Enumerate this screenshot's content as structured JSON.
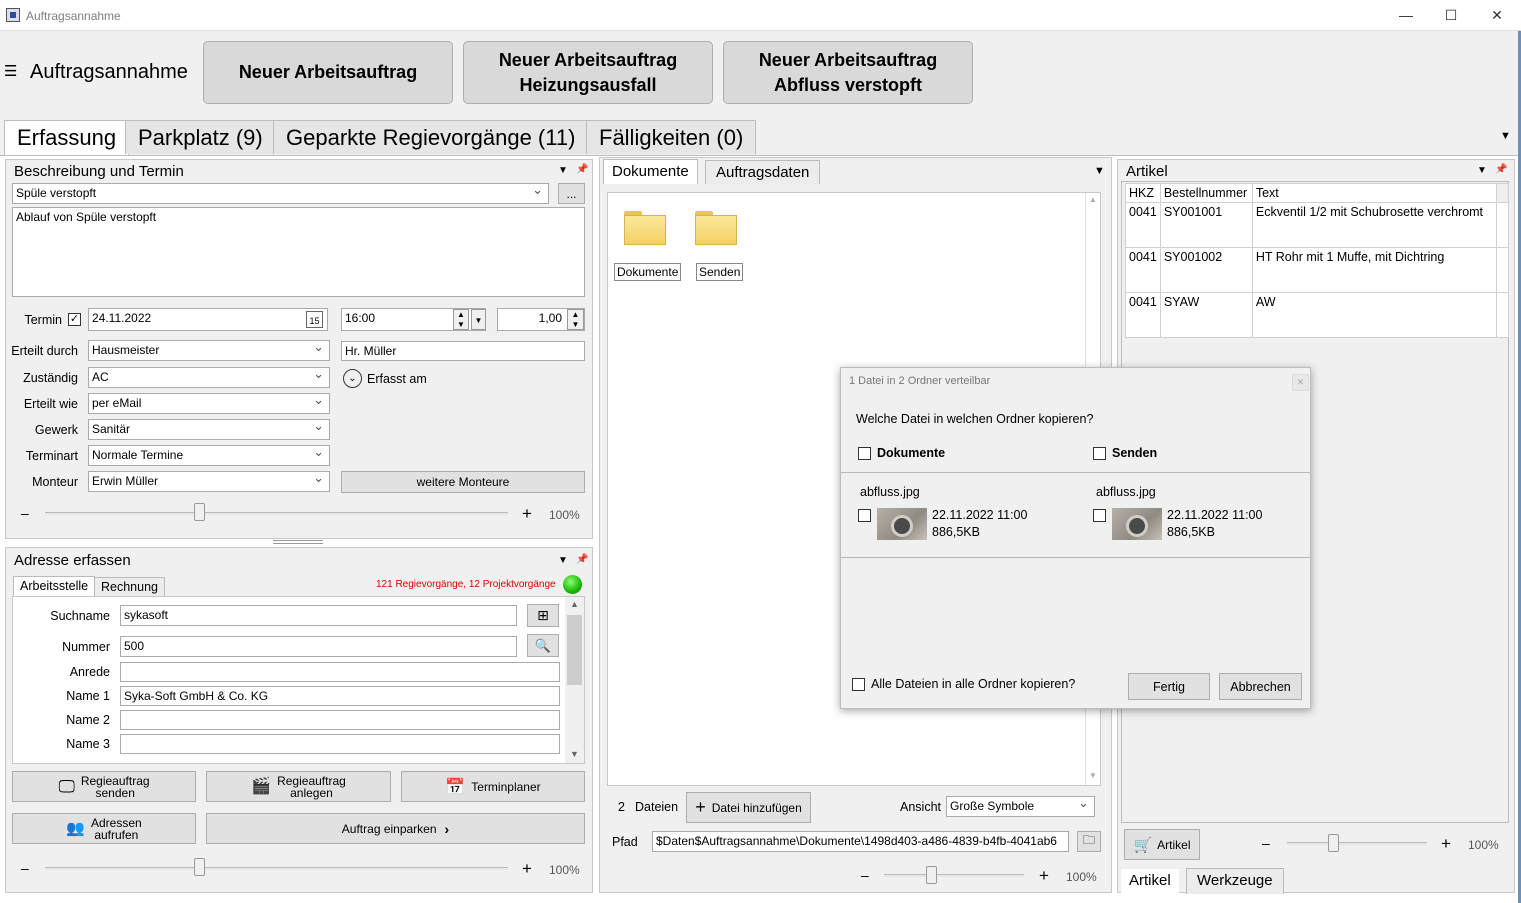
{
  "window": {
    "title": "Auftragsannahme"
  },
  "header": {
    "title": "Auftragsannahme",
    "buttons": [
      "Neuer Arbeitsauftrag",
      "Neuer Arbeitsauftrag\nHeizungsausfall",
      "Neuer Arbeitsauftrag\nAbfluss verstopft"
    ]
  },
  "tabs": [
    "Erfassung",
    "Parkplatz (9)",
    "Geparkte Regievorgänge (11)",
    "Fälligkeiten (0)"
  ],
  "beschreibung": {
    "title": "Beschreibung und Termin",
    "subject": "Spüle verstopft",
    "dots": "...",
    "text": "Ablauf von Spüle verstopft",
    "termin_label": "Termin",
    "date": "24.11.2022",
    "cal_day": "15",
    "time": "16:00",
    "duration": "1,00",
    "fields": [
      {
        "label": "Erteilt durch",
        "value": "Hausmeister"
      },
      {
        "label": "Zuständig",
        "value": "AC"
      },
      {
        "label": "Erteilt wie",
        "value": "per eMail"
      },
      {
        "label": "Gewerk",
        "value": "Sanitär"
      },
      {
        "label": "Terminart",
        "value": "Normale Termine"
      },
      {
        "label": "Monteur",
        "value": "Erwin Müller"
      }
    ],
    "contact": "Hr. Müller",
    "erfasst_am": "Erfasst am",
    "weitere_monteure": "weitere Monteure",
    "zoom": "100%"
  },
  "adresse": {
    "title": "Adresse erfassen",
    "tabs": [
      "Arbeitsstelle",
      "Rechnung"
    ],
    "status": "121 Regievorgänge, 12 Projektvorgänge",
    "fields": [
      {
        "label": "Suchname",
        "value": "sykasoft"
      },
      {
        "label": "Nummer",
        "value": "500"
      },
      {
        "label": "Anrede",
        "value": ""
      },
      {
        "label": "Name 1",
        "value": "Syka-Soft GmbH & Co. KG"
      },
      {
        "label": "Name 2",
        "value": ""
      },
      {
        "label": "Name 3",
        "value": ""
      }
    ],
    "buttons": {
      "regie_senden": "Regieauftrag\nsenden",
      "regie_anlegen": "Regieauftrag\nanlegen",
      "terminplaner": "Terminplaner",
      "adressen": "Adressen\naufrufen",
      "einparken": "Auftrag einparken"
    },
    "zoom": "100%"
  },
  "dokumente": {
    "tabs": [
      "Dokumente",
      "Auftragsdaten"
    ],
    "folders": [
      "Dokumente",
      "Senden"
    ],
    "count": "2",
    "count_label": "Dateien",
    "add_button": "Datei hinzufügen",
    "ansicht_label": "Ansicht",
    "ansicht_value": "Große Symbole",
    "pfad_label": "Pfad",
    "pfad_value": "$Daten$Auftragsannahme\\Dokumente\\1498d403-a486-4839-b4fb-4041ab6",
    "zoom": "100%"
  },
  "artikel": {
    "title": "Artikel",
    "columns": [
      "HKZ",
      "Bestellnummer",
      "Text"
    ],
    "rows": [
      [
        "0041",
        "SY001001",
        "Eckventil 1/2 mit Schubrosette verchromt"
      ],
      [
        "0041",
        "SY001002",
        "HT Rohr mit 1 Muffe, mit Dichtring"
      ],
      [
        "0041",
        "SYAW",
        "AW"
      ]
    ],
    "button": "Artikel",
    "zoom": "100%",
    "tabs": [
      "Artikel",
      "Werkzeuge"
    ]
  },
  "dialog": {
    "title": "1 Datei in 2 Ordner verteilbar",
    "question": "Welche Datei in welchen Ordner kopieren?",
    "folders": [
      "Dokumente",
      "Senden"
    ],
    "files": [
      {
        "name": "abfluss.jpg",
        "date": "22.11.2022 11:00",
        "size": "886,5KB"
      },
      {
        "name": "abfluss.jpg",
        "date": "22.11.2022 11:00",
        "size": "886,5KB"
      }
    ],
    "all_label": "Alle Dateien in alle Ordner kopieren?",
    "ok": "Fertig",
    "cancel": "Abbrechen"
  }
}
